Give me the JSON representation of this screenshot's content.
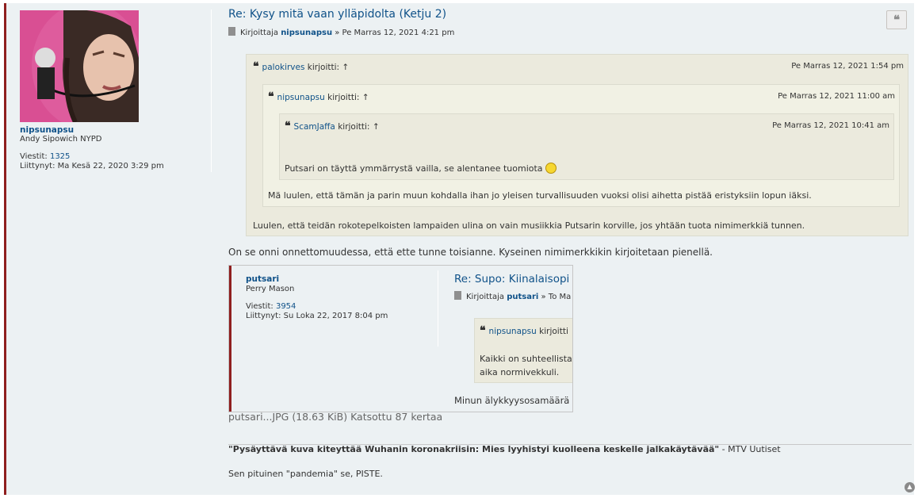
{
  "profile": {
    "username": "nipsunapsu",
    "rank": "Andy Sipowich NYPD",
    "posts_label": "Viestit:",
    "posts_value": "1325",
    "joined_label": "Liittynyt:",
    "joined_value": "Ma Kesä 22, 2020 3:29 pm"
  },
  "post": {
    "title": "Re: Kysy mitä vaan ylläpidolta (Ketju 2)",
    "by_label": "Kirjoittaja",
    "author": "nipsunapsu",
    "date": "» Pe Marras 12, 2021 4:21 pm",
    "quote_button": "❝"
  },
  "quotes": {
    "q1": {
      "name": "palokirves",
      "wrote": "kirjoitti:",
      "arrow": "↑",
      "date": "Pe Marras 12, 2021 1:54 pm",
      "text": "Luulen, että teidän rokotepelkoisten lampaiden ulina on vain musiikkia Putsarin korville, jos yhtään tuota nimimerkkiä tunnen."
    },
    "q2": {
      "name": "nipsunapsu",
      "wrote": "kirjoitti:",
      "arrow": "↑",
      "date": "Pe Marras 12, 2021 11:00 am",
      "text": "Mä luulen, että tämän ja parin muun kohdalla ihan jo yleisen turvallisuuden vuoksi olisi aihetta pistää eristyksiin lopun iäksi."
    },
    "q3": {
      "name": "ScamJaffa",
      "wrote": "kirjoitti:",
      "arrow": "↑",
      "date": "Pe Marras 12, 2021 10:41 am",
      "text": "Putsari on täyttä ymmärrystä vailla, se alentanee tuomiota"
    }
  },
  "body_text": "On se onni onnettomuudessa, että ette tunne toisianne. Kyseinen nimimerkkikin kirjoitetaan pienellä.",
  "attachment": {
    "username": "putsari",
    "rank": "Perry Mason",
    "posts_label": "Viestit:",
    "posts_value": "3954",
    "joined_label": "Liittynyt:",
    "joined_value": "Su Loka 22, 2017 8:04 pm",
    "title": "Re: Supo: Kiinalaisopi",
    "by_label": "Kirjoittaja",
    "author": "putsari",
    "date_frag": "» To Ma",
    "quote_name": "nipsunapsu",
    "quote_wrote": "kirjoitti",
    "quote_text1": "Kaikki on suhteellista",
    "quote_text2": "aika normivekkuli.",
    "tail": "Minun älykkyysosamäärä o",
    "caption": "putsari...JPG (18.63 KiB) Katsottu 87 kertaa"
  },
  "signature": {
    "headline": "\"Pysäyttävä kuva kiteyttää Wuhanin koronakriisin: Mies lyyhistyi kuolleena keskelle jalkakäytävää\"",
    "source": " - MTV Uutiset",
    "line2": "Sen pituinen \"pandemia\" se, PISTE."
  },
  "colors": {
    "accent": "#105289",
    "post_border": "#8f1f1f",
    "post_bg": "#ecf1f3",
    "quote_bg": "#ebeadd"
  }
}
